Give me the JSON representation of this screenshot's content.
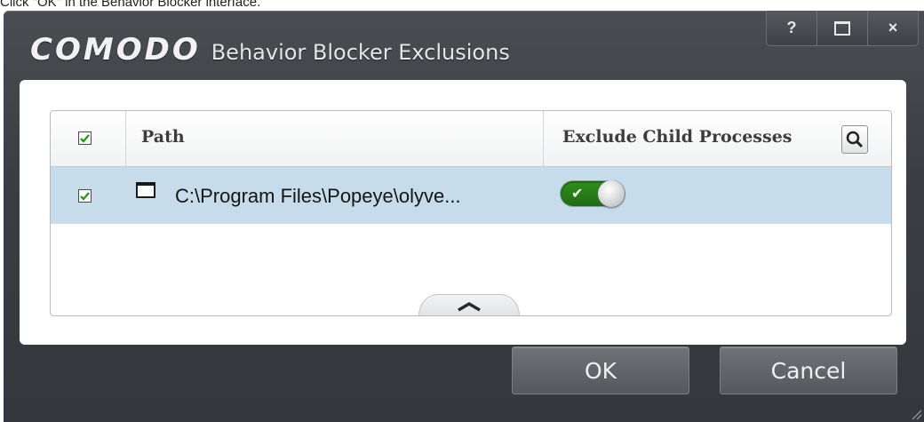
{
  "caption": "Click \"OK\" in the Behavior Blocker interface.",
  "window": {
    "brand": "COMODO",
    "title": "Behavior Blocker Exclusions",
    "help_label": "?",
    "close_label": "×"
  },
  "table": {
    "columns": {
      "path": "Path",
      "exclude_child": "Exclude Child Processes"
    },
    "header_checked": true,
    "rows": [
      {
        "checked": true,
        "icon": "application-window-icon",
        "path": "C:\\Program Files\\Popeye\\olyve...",
        "exclude_child_processes": true
      }
    ]
  },
  "buttons": {
    "ok": "OK",
    "cancel": "Cancel"
  },
  "colors": {
    "window_bg": "#3b3e43",
    "row_selected": "#c6dcea",
    "toggle_on": "#2f8f1e"
  }
}
